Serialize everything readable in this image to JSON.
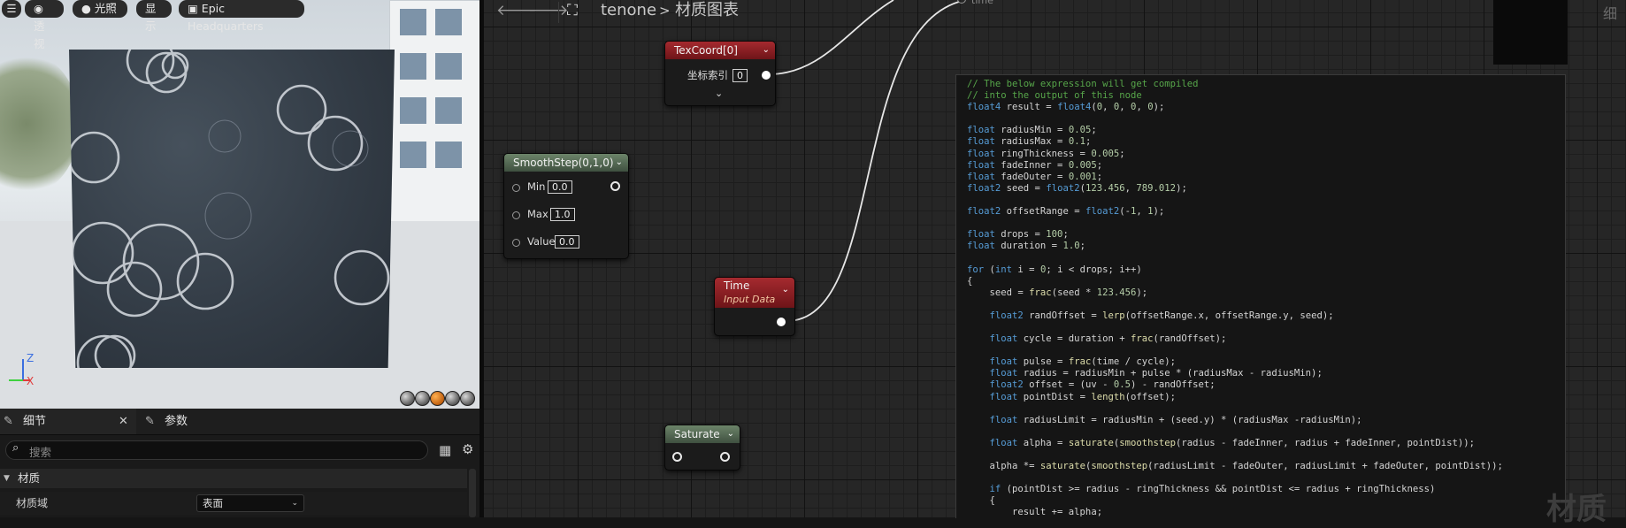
{
  "viewport": {
    "buttons": [
      {
        "label": "透视",
        "icon": "perspective-icon"
      },
      {
        "label": "光照",
        "icon": "lit-icon"
      },
      {
        "label": "显示",
        "icon": ""
      },
      {
        "label": "Epic Headquarters",
        "icon": "preview-scene-icon"
      }
    ],
    "axis": {
      "z": "Z",
      "x": "X"
    },
    "preview_shapes": [
      "cylinder",
      "sphere",
      "plane",
      "cube",
      "mesh"
    ]
  },
  "details": {
    "tabs": [
      {
        "label": "细节",
        "icon": "pencil-icon",
        "active": true,
        "closable": true
      },
      {
        "label": "参数",
        "icon": "pencil-icon",
        "active": false,
        "closable": false
      }
    ],
    "search_placeholder": "搜索",
    "section": "材质",
    "properties": [
      {
        "label": "材质域",
        "value": "表面"
      }
    ]
  },
  "graph": {
    "breadcrumb": {
      "asset": "tenone",
      "separator": ">",
      "graph": "材质图表"
    },
    "nodes": {
      "texcoord": {
        "title": "TexCoord[0]",
        "pin_label": "坐标索引",
        "pin_value": "0"
      },
      "smoothstep": {
        "title": "SmoothStep(0,1,0)",
        "pins": [
          {
            "label": "Min",
            "value": "0.0"
          },
          {
            "label": "Max",
            "value": "1.0"
          },
          {
            "label": "Value",
            "value": "0.0"
          }
        ]
      },
      "time": {
        "title": "Time",
        "subtitle": "Input Data"
      },
      "saturate": {
        "title": "Saturate"
      },
      "custom": {
        "input_label": "time"
      }
    },
    "code_lines": [
      "// The below expression will get compiled",
      "// into the output of this node",
      "float4 result = float4(0, 0, 0, 0);",
      "",
      "float radiusMin = 0.05;",
      "float radiusMax = 0.1;",
      "float ringThickness = 0.005;",
      "float fadeInner = 0.005;",
      "float fadeOuter = 0.001;",
      "float2 seed = float2(123.456, 789.012);",
      "",
      "float2 offsetRange = float2(-1, 1);",
      "",
      "float drops = 100;",
      "float duration = 1.0;",
      "",
      "for (int i = 0; i < drops; i++)",
      "{",
      "    seed = frac(seed * 123.456);",
      "",
      "    float2 randOffset = lerp(offsetRange.x, offsetRange.y, seed);",
      "",
      "    float cycle = duration + frac(randOffset);",
      "",
      "    float pulse = frac(time / cycle);",
      "    float radius = radiusMin + pulse * (radiusMax - radiusMin);",
      "    float2 offset = (uv - 0.5) - randOffset;",
      "    float pointDist = length(offset);",
      "",
      "    float radiusLimit = radiusMin + (seed.y) * (radiusMax -radiusMin);",
      "",
      "    float alpha = saturate(smoothstep(radius - fadeInner, radius + fadeInner, pointDist));",
      "",
      "    alpha *= saturate(smoothstep(radiusLimit - fadeOuter, radiusLimit + fadeOuter, pointDist));",
      "",
      "    if (pointDist >= radius - ringThickness && pointDist <= radius + ringThickness)",
      "    {",
      "        result += alpha;"
    ],
    "watermark": "材质",
    "corner_text": "细"
  }
}
